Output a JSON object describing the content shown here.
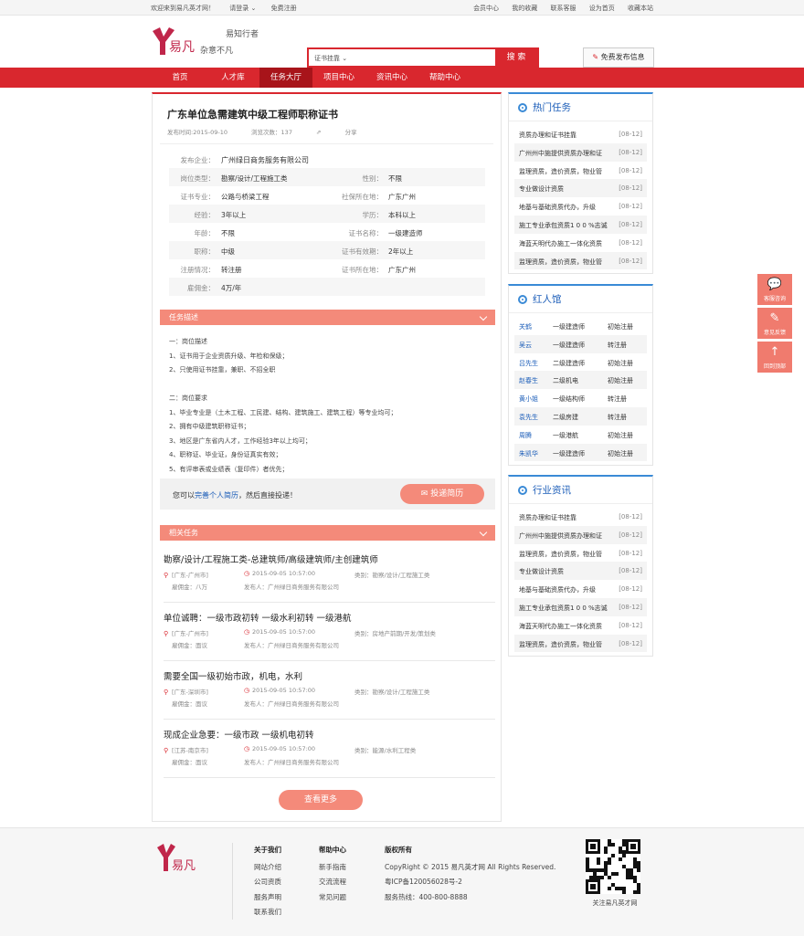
{
  "topbar": {
    "welcome": "欢迎来到易凡英才网！",
    "login": "请登录",
    "register": "免费注册",
    "links": [
      "会员中心",
      "我的收藏",
      "联系客服",
      "设为首页",
      "收藏本站"
    ]
  },
  "header": {
    "logo_text": "易凡",
    "slogan_a": "易知行者",
    "slogan_b": "杂意不凡",
    "search_select": "证书挂靠",
    "search_button": "搜 索",
    "publish": "免费发布信息"
  },
  "nav": [
    "首页",
    "人才库",
    "任务大厅",
    "项目中心",
    "资讯中心",
    "帮助中心"
  ],
  "task": {
    "title": "广东单位急需建筑中级工程师职称证书",
    "publish_time": "发布时间:2015-09-10",
    "views": "浏览次数：137",
    "share": "分享",
    "company_label": "发布企业：",
    "company": "广州绿日商务服务有限公司",
    "fields": [
      {
        "l1": "岗位类型：",
        "v1": "勘察/设计/工程施工类",
        "l2": "性别：",
        "v2": "不限"
      },
      {
        "l1": "证书专业：",
        "v1": "公路与桥梁工程",
        "l2": "社保所在地：",
        "v2": "广东广州"
      },
      {
        "l1": "经验：",
        "v1": "3年以上",
        "l2": "学历：",
        "v2": "本科以上"
      },
      {
        "l1": "年龄：",
        "v1": "不限",
        "l2": "证书名称：",
        "v2": "一级建造师"
      },
      {
        "l1": "职称：",
        "v1": "中级",
        "l2": "证书有效期：",
        "v2": "2年以上"
      },
      {
        "l1": "注册情况：",
        "v1": "转注册",
        "l2": "证书所在地：",
        "v2": "广东广州"
      }
    ],
    "salary_label": "雇佣金：",
    "salary": "4万/年"
  },
  "desc": {
    "header": "任务描述",
    "text": "一：岗位描述\n1、证书用于企业资质升级、年检和保级；\n2、只使用证书挂靠，兼职、不招全职\n\n二：岗位要求\n1、毕业专业是（土木工程、工民建、结构、建筑施工、建筑工程）等专业均可；\n2、拥有中级建筑职称证书；\n3、地区是广东省内人才，工作经验3年以上均可；\n4、职称证、毕业证，身份证真实有效；\n5、有评审表或业绩表（复印件）者优先；"
  },
  "apply": {
    "prefix": "您可以",
    "link": "完善个人简历",
    "suffix": "，然后直接投递！",
    "button": "投递简历"
  },
  "related": {
    "header": "相关任务",
    "items": [
      {
        "title": "勘察/设计/工程施工类-总建筑师/高级建筑师/主创建筑师",
        "loc": "[广东-广州市]",
        "time": "2015-09-05 10:57:00",
        "cat": "类别：勘察/设计/工程施工类",
        "salary": "雇佣金：八万",
        "pub": "发布人：广州绿日商务服务有限公司"
      },
      {
        "title": "单位诚聘：一级市政初转 一级水利初转 一级港航",
        "loc": "[广东-广州市]",
        "time": "2015-09-05 10:57:00",
        "cat": "类别：房地产前期/开发/策划类",
        "salary": "雇佣金：面议",
        "pub": "发布人：广州绿日商务服务有限公司"
      },
      {
        "title": "需要全国一级初始市政，机电，水利",
        "loc": "[广东-深圳市]",
        "time": "2015-09-05 10:57:00",
        "cat": "类别：勘察/设计/工程施工类",
        "salary": "雇佣金：面议",
        "pub": "发布人：广州绿日商务服务有限公司"
      },
      {
        "title": "现成企业急要：一级市政 一级机电初转",
        "loc": "[江苏-南京市]",
        "time": "2015-09-05 10:57:00",
        "cat": "类别：能源/水利工程类",
        "salary": "雇佣金：面议",
        "pub": "发布人：广州绿日商务服务有限公司"
      }
    ],
    "more": "查看更多"
  },
  "hot": {
    "title": "热门任务",
    "items": [
      {
        "n": "资质办理和证书挂靠",
        "d": "[08-12]"
      },
      {
        "n": "广州州中施提供资质办理和证",
        "d": "[08-12]"
      },
      {
        "n": "监理资质，造价资质，物业管",
        "d": "[08-12]"
      },
      {
        "n": "专业做设计资质",
        "d": "[08-12]"
      },
      {
        "n": "地基与基础资质代办，升级",
        "d": "[08-12]"
      },
      {
        "n": "施工专业承包资质1 0 0 %志诚",
        "d": "[08-12]"
      },
      {
        "n": "海蓝天明代办施工一体化资质",
        "d": "[08-12]"
      },
      {
        "n": "监理资质，造价资质，物业管",
        "d": "[08-12]"
      }
    ]
  },
  "stars": {
    "title": "红人馆",
    "items": [
      {
        "n": "关鹤",
        "c": "一级建造师",
        "s": "初始注册"
      },
      {
        "n": "吴云",
        "c": "一级建造师",
        "s": "转注册"
      },
      {
        "n": "吕先生",
        "c": "二级建造师",
        "s": "初始注册"
      },
      {
        "n": "赵春生",
        "c": "二级机电",
        "s": "初始注册"
      },
      {
        "n": "黄小姐",
        "c": "一级结构师",
        "s": "转注册"
      },
      {
        "n": "袁先生",
        "c": "二级房建",
        "s": "转注册"
      },
      {
        "n": "周腾",
        "c": "一级港航",
        "s": "初始注册"
      },
      {
        "n": "朱凯华",
        "c": "一级建造师",
        "s": "初始注册"
      }
    ]
  },
  "news": {
    "title": "行业资讯",
    "items": [
      {
        "n": "资质办理和证书挂靠",
        "d": "[08-12]"
      },
      {
        "n": "广州州中施提供资质办理和证",
        "d": "[08-12]"
      },
      {
        "n": "监理资质，造价资质，物业管",
        "d": "[08-12]"
      },
      {
        "n": "专业做设计资质",
        "d": "[08-12]"
      },
      {
        "n": "地基与基础资质代办，升级",
        "d": "[08-12]"
      },
      {
        "n": "施工专业承包资质1 0 0 %志诚",
        "d": "[08-12]"
      },
      {
        "n": "海蓝天明代办施工一体化资质",
        "d": "[08-12]"
      },
      {
        "n": "监理资质，造价资质，物业管",
        "d": "[08-12]"
      }
    ]
  },
  "float": [
    {
      "icon": "chat-icon",
      "label": "客服咨询"
    },
    {
      "icon": "edit-icon",
      "label": "意见反馈"
    },
    {
      "icon": "arrow-up-icon",
      "label": "回到顶部"
    }
  ],
  "footer": {
    "logo_text": "易凡",
    "about": {
      "h": "关于我们",
      "items": [
        "网站介绍",
        "公司资质",
        "服务声明",
        "联系我们"
      ]
    },
    "help": {
      "h": "帮助中心",
      "items": [
        "新手指南",
        "交流流程",
        "常见问题"
      ]
    },
    "rights": {
      "h": "版权所有",
      "items": [
        "CopyRight © 2015 易凡英才网 All Rights Reserved.",
        "粤ICP备120056028号-2",
        "服务热线：400-800-8888"
      ]
    },
    "qr_caption": "关注易凡英才网"
  },
  "colors": {
    "brand": "#d9272e",
    "accent": "#f48a7a",
    "link": "#1a5cb8",
    "side_accent": "#3a8ad6"
  }
}
